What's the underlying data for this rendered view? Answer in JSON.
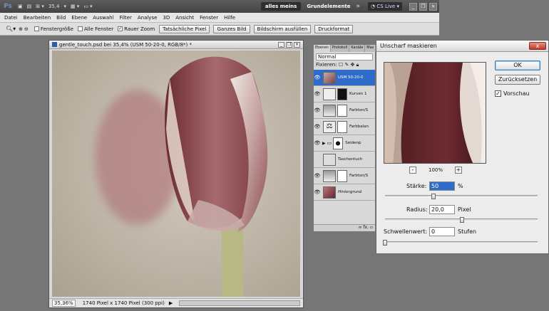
{
  "app": {
    "logo": "Ps",
    "zoom": "35,4",
    "workspace": "alles meins",
    "essentials": "Grundelemente",
    "more": "»",
    "cslive": "CS Live"
  },
  "menu": [
    "Datei",
    "Bearbeiten",
    "Bild",
    "Ebene",
    "Auswahl",
    "Filter",
    "Analyse",
    "3D",
    "Ansicht",
    "Fenster",
    "Hilfe"
  ],
  "options": {
    "resize_windows": "Fenstergröße",
    "all_windows": "Alle Fenster",
    "scrubby_zoom": "Rauer Zoom",
    "actual_pixels": "Tatsächliche Pixel",
    "fit_screen": "Ganzes Bild",
    "fill_screen": "Bildschirm ausfüllen",
    "print_size": "Druckformat"
  },
  "document": {
    "title": "gentle_touch.psd bei 35,4% (USM 50-20-0, RGB/8*) *",
    "status_zoom": "35,36%",
    "status_info": "1740 Pixel x 1740 Pixel (300 ppi)"
  },
  "layers_panel": {
    "tabs": [
      "Ebenen",
      "Protokoll",
      "Kanäle",
      "Mas"
    ],
    "mode": "Normal",
    "lock_label": "Fixieren:",
    "layers": [
      {
        "name": "USM 50-20-0",
        "selected": true
      },
      {
        "name": "Kurven 1"
      },
      {
        "name": "Farbton/S"
      },
      {
        "name": "Farbbalan"
      },
      {
        "name": "Seidenp"
      },
      {
        "name": "Taschentuch"
      },
      {
        "name": "Farbton/S"
      },
      {
        "name": "Hintergrund"
      }
    ],
    "footer": "fx."
  },
  "dialog": {
    "title": "Unscharf maskieren",
    "close": "x",
    "ok": "OK",
    "reset": "Zurücksetzen",
    "preview_label": "Vorschau",
    "preview_checked": true,
    "zoom_minus": "-",
    "zoom_value": "100%",
    "zoom_plus": "+",
    "amount_label": "Stärke:",
    "amount_value": "50",
    "amount_unit": "%",
    "radius_label": "Radius:",
    "radius_value": "20,0",
    "radius_unit": "Pixel",
    "threshold_label": "Schwellenwert:",
    "threshold_value": "0",
    "threshold_unit": "Stufen"
  }
}
